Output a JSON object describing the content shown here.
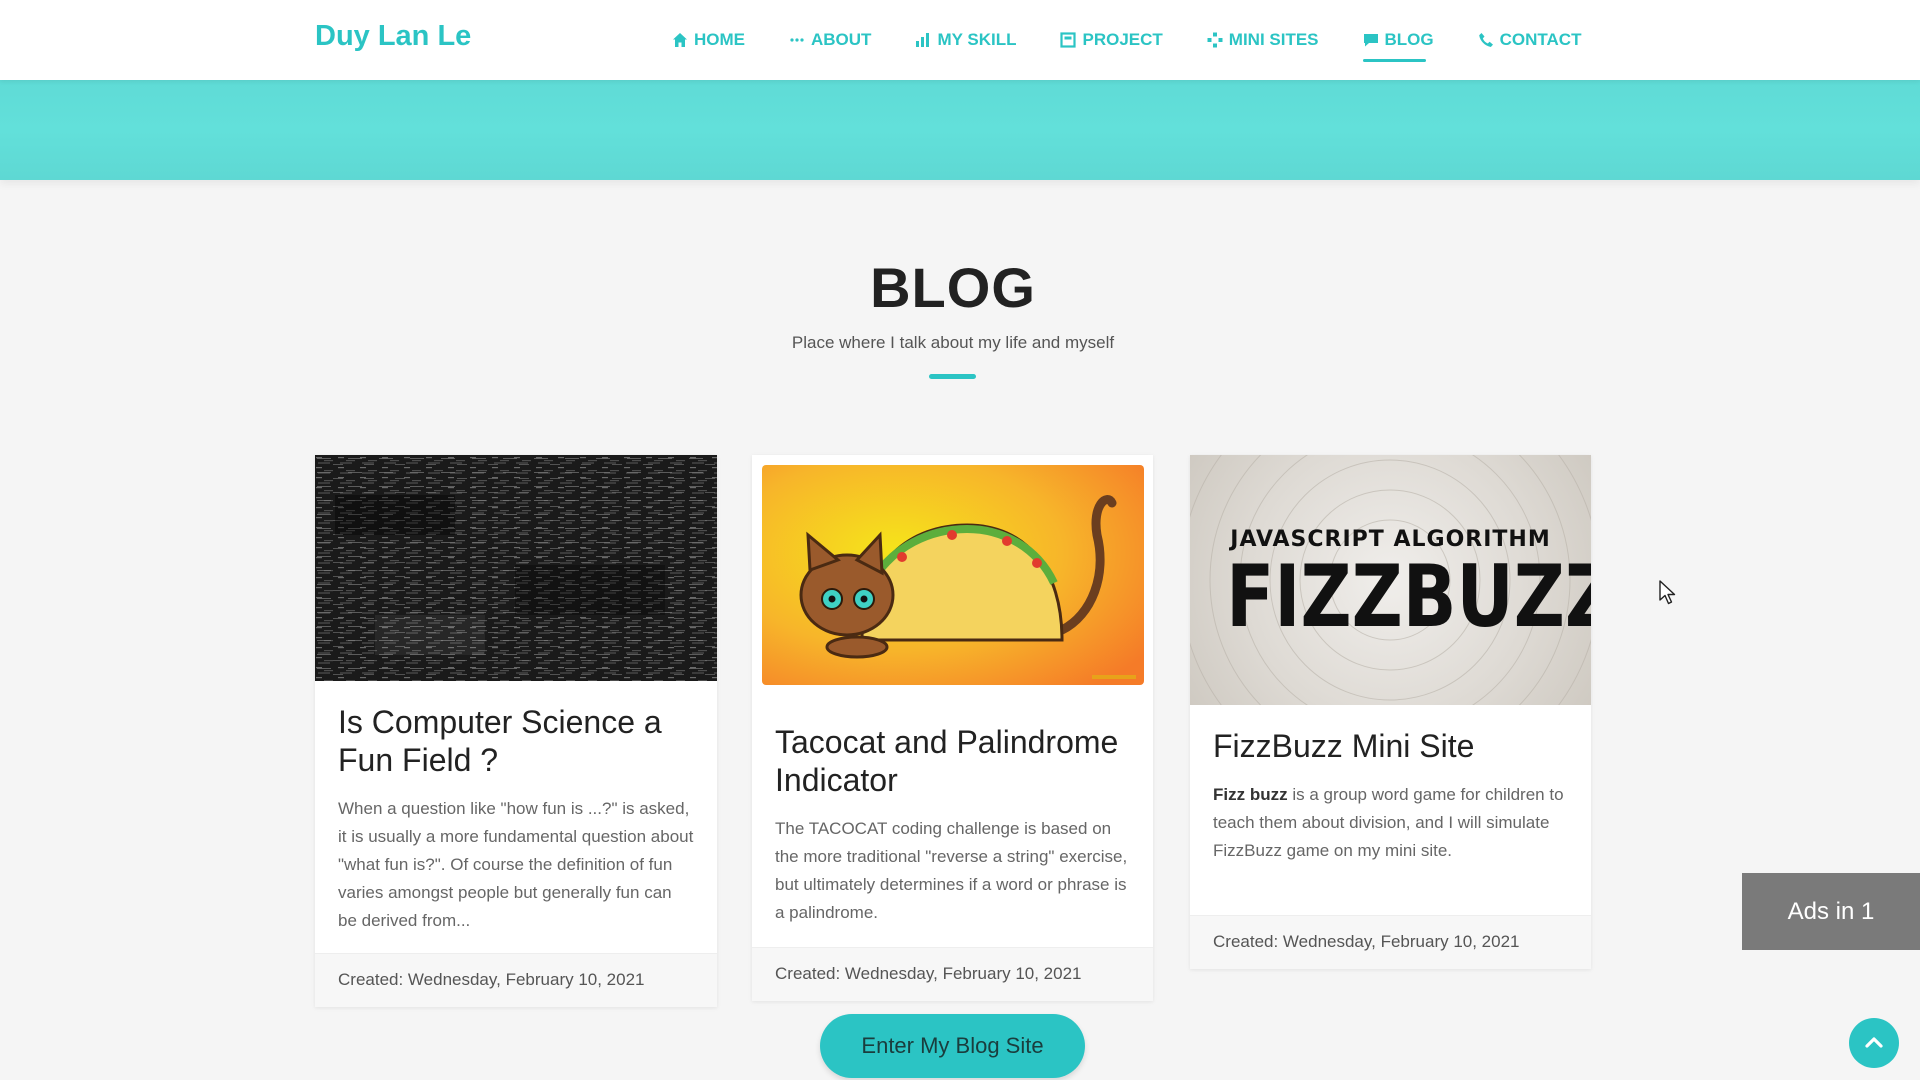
{
  "navbar": {
    "brand": "Duy Lan Le",
    "items": [
      {
        "label": "HOME",
        "icon": "home-icon"
      },
      {
        "label": "ABOUT",
        "icon": "dots-icon"
      },
      {
        "label": "MY SKILL",
        "icon": "bar-chart-icon"
      },
      {
        "label": "PROJECT",
        "icon": "project-icon"
      },
      {
        "label": "MINI SITES",
        "icon": "sitemap-icon"
      },
      {
        "label": "BLOG",
        "icon": "comment-icon",
        "active": true
      },
      {
        "label": "CONTACT",
        "icon": "phone-icon"
      }
    ]
  },
  "section": {
    "title": "BLOG",
    "subtitle": "Place where I talk about my life and myself"
  },
  "cards": [
    {
      "image": "binary-code-image",
      "title": "Is Computer Science a Fun Field ?",
      "text": "When a question like \"how fun is ...?\" is asked, it is usually a more fundamental question about \"what fun is?\". Of course the definition of fun varies amongst people but generally fun can be derived from...",
      "footer": "Created: Wednesday, February 10, 2021"
    },
    {
      "image": "tacocat-image",
      "title": "Tacocat and Palindrome Indicator",
      "text": "The TACOCAT coding challenge is based on the more traditional \"reverse a string\" exercise, but ultimately determines if a word or phrase is a palindrome.",
      "footer": "Created: Wednesday, February 10, 2021"
    },
    {
      "image": "fizzbuzz-image",
      "image_text_top": "JAVASCRIPT ALGORITHM",
      "image_text_main": "FIZZBUZZ",
      "title": "FizzBuzz Mini Site",
      "text_bold": "Fizz buzz",
      "text": " is a group word game for children to teach them about division, and I will simulate FizzBuzz game on my mini site.",
      "footer": "Created: Wednesday, February 10, 2021"
    }
  ],
  "blog_button": "Enter My Blog Site",
  "ads": "Ads in 1",
  "colors": {
    "accent": "#2bc4c4",
    "band": "#62e0da",
    "background": "#f5f5f5"
  }
}
